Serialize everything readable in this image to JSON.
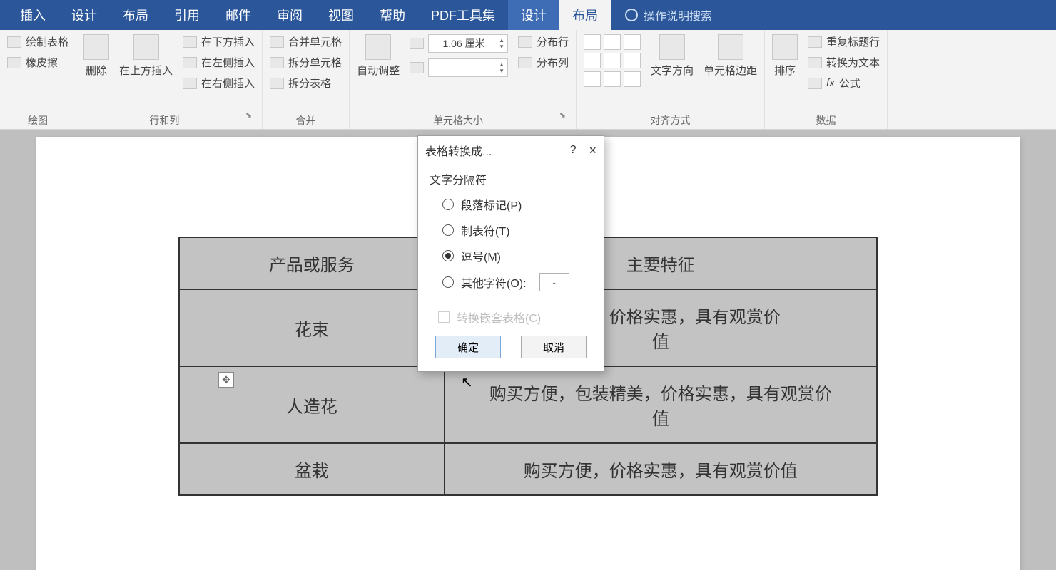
{
  "ribbon": {
    "tabs": [
      "插入",
      "设计",
      "布局",
      "引用",
      "邮件",
      "审阅",
      "视图",
      "帮助",
      "PDF工具集",
      "设计",
      "布局"
    ],
    "active_index": 10,
    "tell_me": "操作说明搜索",
    "groups": {
      "draw": {
        "label": "绘图",
        "draw_table": "绘制表格",
        "eraser": "橡皮擦"
      },
      "rows_cols": {
        "label": "行和列",
        "delete": "删除",
        "insert_above": "在上方插入",
        "insert_below": "在下方插入",
        "insert_left": "在左侧插入",
        "insert_right": "在右侧插入"
      },
      "merge": {
        "label": "合并",
        "merge_cells": "合并单元格",
        "split_cells": "拆分单元格",
        "split_table": "拆分表格"
      },
      "cell_size": {
        "label": "单元格大小",
        "autofit": "自动调整",
        "height_value": "1.06 厘米",
        "dist_rows": "分布行",
        "dist_cols": "分布列"
      },
      "alignment": {
        "label": "对齐方式",
        "text_dir": "文字方向",
        "cell_margins": "单元格边距"
      },
      "data": {
        "label": "数据",
        "sort": "排序",
        "repeat_header": "重复标题行",
        "convert_text": "转换为文本",
        "formula": "公式"
      }
    }
  },
  "table": {
    "header": [
      "产品或服务",
      "",
      "主要特征"
    ],
    "rows": [
      {
        "c1": "花束",
        "c3_line1": "表精美，价格实惠，具有观赏价",
        "c3_line2": "值"
      },
      {
        "c1": "人造花",
        "c3_line1": "购买方便，包装精美，价格实惠，具有观赏价",
        "c3_line2": "值"
      },
      {
        "c1": "盆栽",
        "c3_line1": "购买方便，价格实惠，具有观赏价值",
        "c3_line2": ""
      }
    ]
  },
  "dialog": {
    "title": "表格转换成...",
    "help": "?",
    "close": "×",
    "separator_label": "文字分隔符",
    "opt_paragraph": "段落标记(P)",
    "opt_tab": "制表符(T)",
    "opt_comma": "逗号(M)",
    "opt_other": "其他字符(O):",
    "other_value": "-",
    "selected": "comma",
    "nested": "转换嵌套表格(C)",
    "ok": "确定",
    "cancel": "取消"
  }
}
